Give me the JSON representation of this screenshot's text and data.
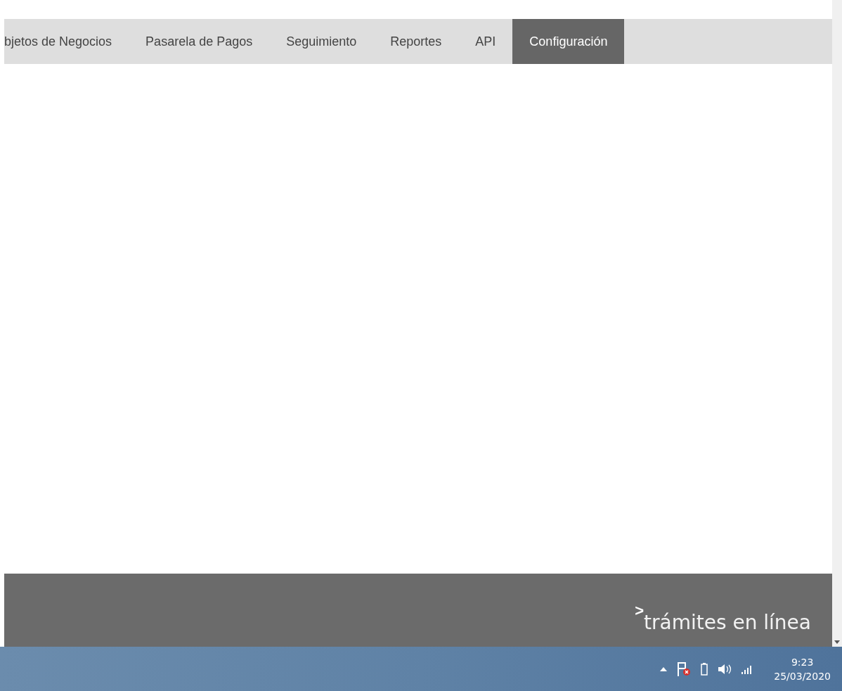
{
  "nav": {
    "tabs": [
      {
        "label": "bjetos de Negocios",
        "selected": false
      },
      {
        "label": "Pasarela de Pagos",
        "selected": false
      },
      {
        "label": "Seguimiento",
        "selected": false
      },
      {
        "label": "Reportes",
        "selected": false
      },
      {
        "label": "API",
        "selected": false
      },
      {
        "label": "Configuración",
        "selected": true
      }
    ]
  },
  "footer": {
    "logo_mark": ">",
    "logo_text": "trámites en línea"
  },
  "taskbar": {
    "time": "9:23",
    "date": "25/03/2020"
  }
}
